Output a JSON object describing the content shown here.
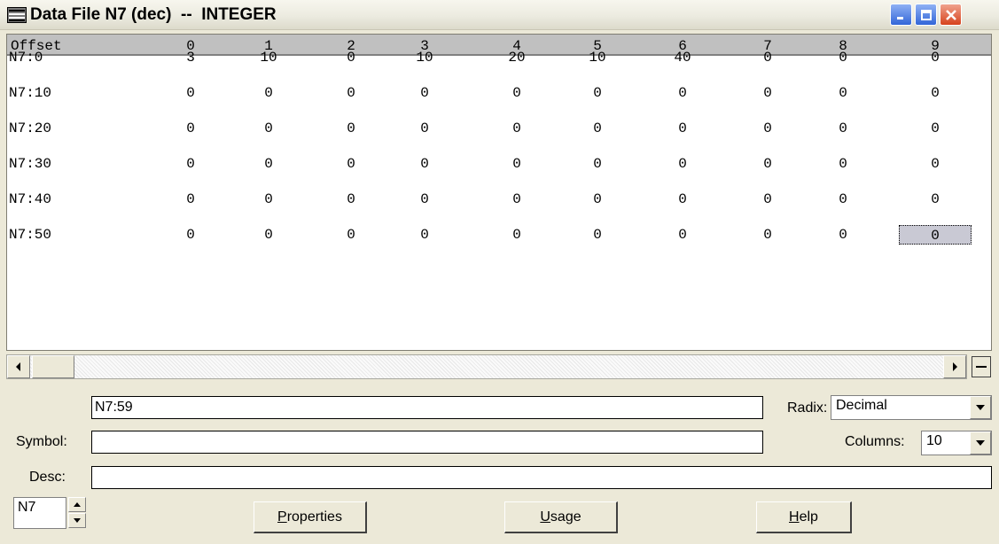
{
  "window": {
    "title": "Data File N7 (dec)  --  INTEGER",
    "icon": "data-table-icon",
    "buttons": [
      "minimize-icon",
      "maximize-icon",
      "close-icon"
    ]
  },
  "grid": {
    "offset_header": "Offset",
    "columns": [
      "0",
      "1",
      "2",
      "3",
      "4",
      "5",
      "6",
      "7",
      "8",
      "9"
    ],
    "rows": [
      {
        "label": "N7:0",
        "values": [
          "3",
          "10",
          "0",
          "10",
          "20",
          "10",
          "40",
          "0",
          "0",
          "0"
        ]
      },
      {
        "label": "N7:10",
        "values": [
          "0",
          "0",
          "0",
          "0",
          "0",
          "0",
          "0",
          "0",
          "0",
          "0"
        ]
      },
      {
        "label": "N7:20",
        "values": [
          "0",
          "0",
          "0",
          "0",
          "0",
          "0",
          "0",
          "0",
          "0",
          "0"
        ]
      },
      {
        "label": "N7:30",
        "values": [
          "0",
          "0",
          "0",
          "0",
          "0",
          "0",
          "0",
          "0",
          "0",
          "0"
        ]
      },
      {
        "label": "N7:40",
        "values": [
          "0",
          "0",
          "0",
          "0",
          "0",
          "0",
          "0",
          "0",
          "0",
          "0"
        ]
      },
      {
        "label": "N7:50",
        "values": [
          "0",
          "0",
          "0",
          "0",
          "0",
          "0",
          "0",
          "0",
          "0",
          "0"
        ]
      }
    ],
    "selected": {
      "row": 5,
      "col": 9
    }
  },
  "address_field": {
    "value": "N7:59"
  },
  "symbol": {
    "label": "Symbol:",
    "value": ""
  },
  "desc": {
    "label": "Desc:",
    "value": ""
  },
  "radix": {
    "label": "Radix:",
    "value": "Decimal"
  },
  "columns_select": {
    "label": "Columns:",
    "value": "10"
  },
  "file_spinner": {
    "value": "N7"
  },
  "buttons": {
    "properties": {
      "mnemonic": "P",
      "rest": "roperties"
    },
    "usage": {
      "mnemonic": "U",
      "rest": "sage"
    },
    "help": {
      "mnemonic": "H",
      "rest": "elp"
    }
  },
  "colors": {
    "selected_cell": "#c9c9d4",
    "header_bg": "#c0c0c0",
    "window_bg": "#ece9d8"
  }
}
